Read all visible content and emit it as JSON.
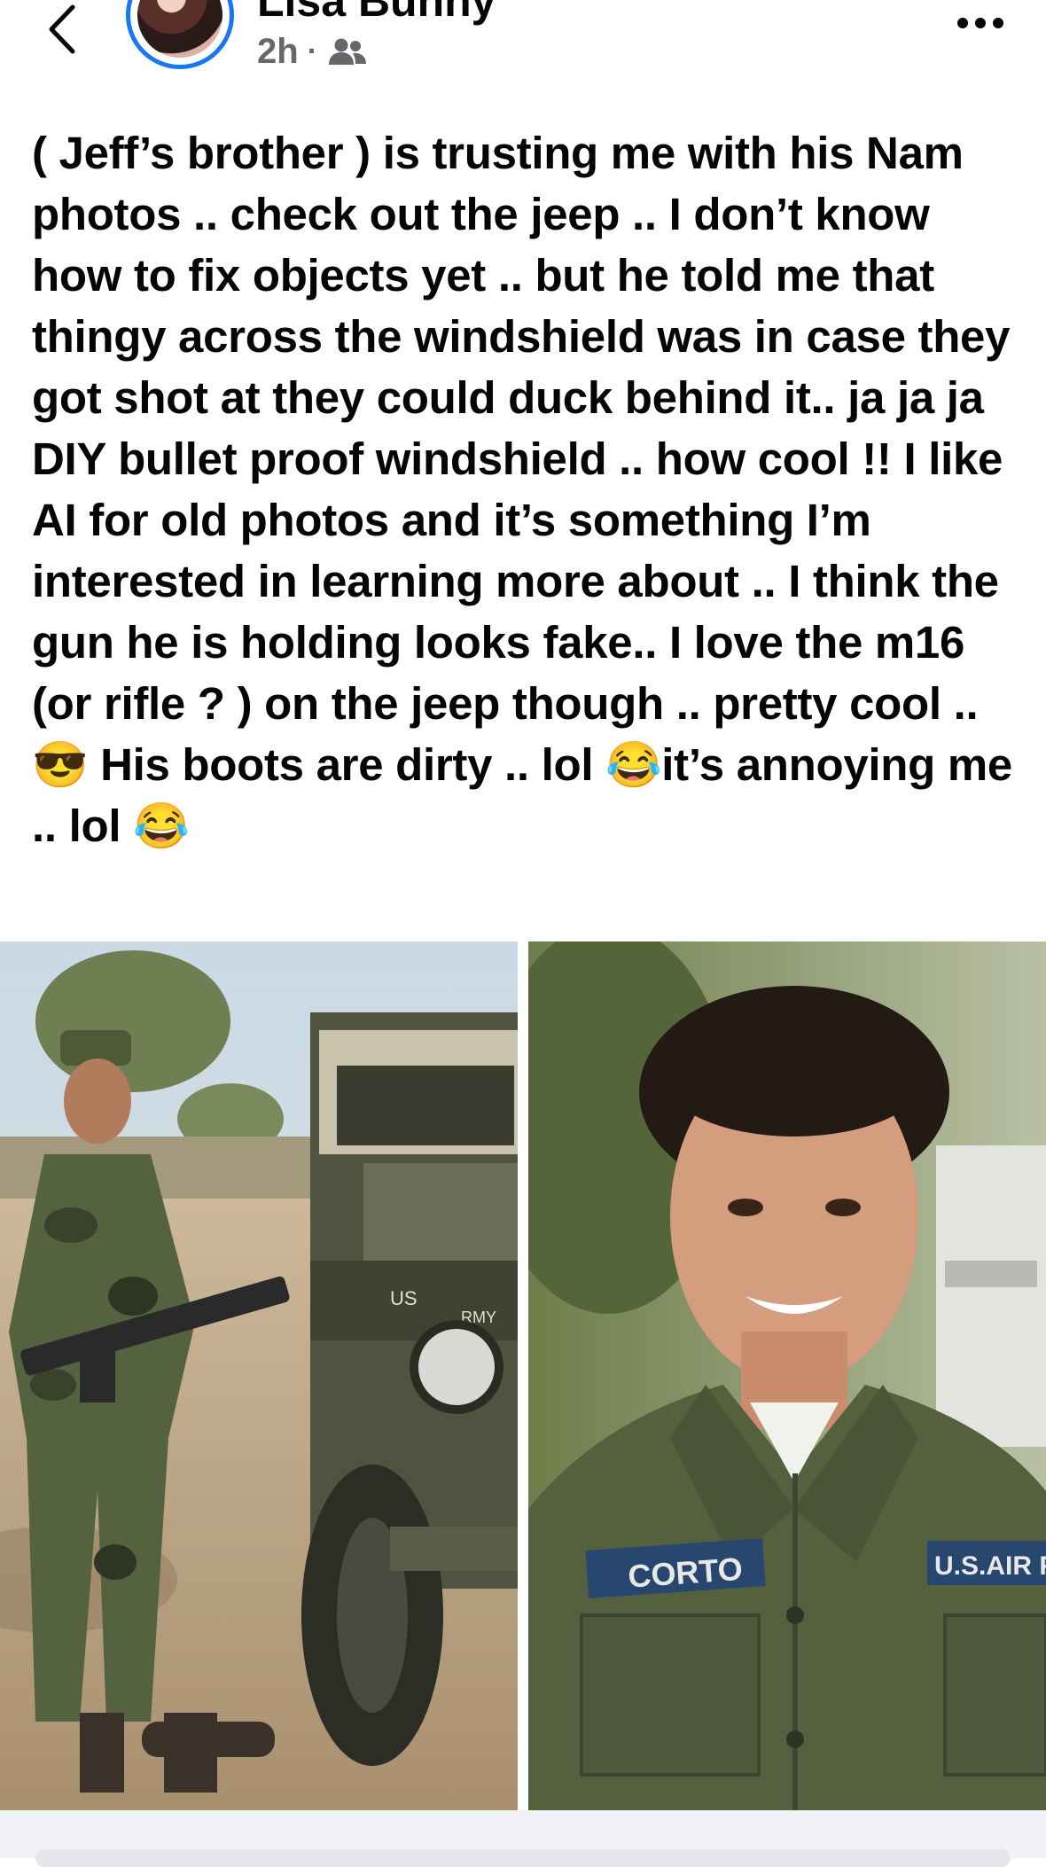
{
  "post": {
    "author": "Lisa Bunny",
    "time": "2h",
    "separator": "·",
    "audience_icon": "friends-icon",
    "text": "( Jeff’s brother ) is trusting me with his Nam photos .. check out the jeep .. I don’t know how to fix objects yet .. but he told me that thingy across the windshield was in case they got shot at they could duck behind it..  ja ja ja DIY bullet proof windshield .. how cool !! I like AI for old photos and it’s something I’m interested in learning more about .. I think the gun  he is holding looks fake.. I love the m16 (or rifle ? ) on the jeep though  .. pretty cool .. 😎 His boots are dirty .. lol 😂it’s annoying me .. lol 😂"
  },
  "photos": {
    "left_jeep_text": "US",
    "left_jeep_text2": "RMY",
    "right_name_tape": "CORTO",
    "right_service_tape": "U.S.AIR F"
  },
  "colors": {
    "accent": "#1877f2",
    "secondary_text": "#65676b"
  }
}
